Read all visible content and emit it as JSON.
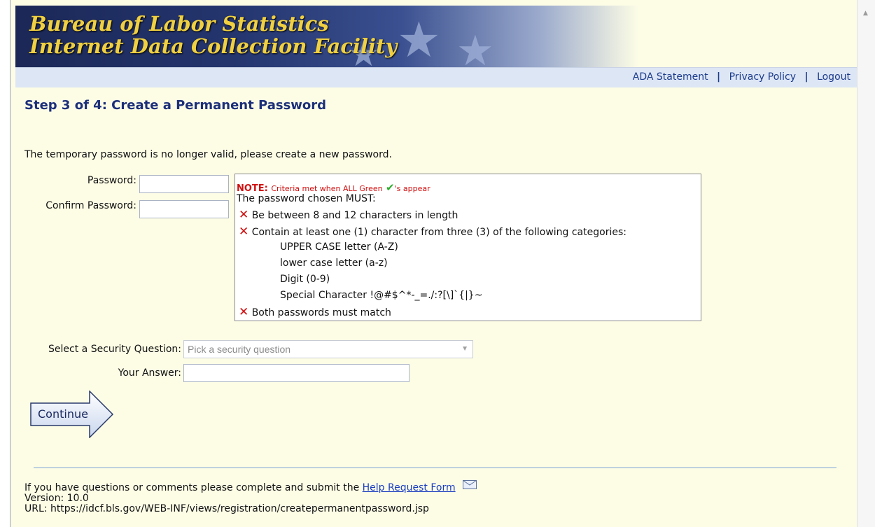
{
  "banner": {
    "line1": "Bureau of Labor Statistics",
    "line2": "Internet Data Collection Facility"
  },
  "nav": {
    "links": [
      "ADA Statement",
      "Privacy Policy",
      "Logout"
    ],
    "separator": "|"
  },
  "page": {
    "step_title": "Step 3 of 4: Create a Permanent Password",
    "intro": "The temporary password is no longer valid, please create a new password."
  },
  "form": {
    "password_label": "Password:",
    "password_value": "",
    "confirm_label": "Confirm Password:",
    "confirm_value": "",
    "security_label": "Select a Security Question:",
    "security_placeholder": "Pick a security question",
    "answer_label": "Your Answer:",
    "answer_value": "",
    "continue_label": "Continue"
  },
  "criteria": {
    "note_label": "NOTE:",
    "note_text_before": "Criteria met when ALL Green",
    "note_text_after": "'s appear",
    "heading": "The password chosen MUST:",
    "rule_length": "Be between 8 and 12 characters in length",
    "rule_categories": "Contain at least one (1) character from three (3) of the following categories:",
    "categories": [
      "UPPER CASE letter (A-Z)",
      "lower case letter (a-z)",
      "Digit (0-9)",
      "Special Character !@#$^*-_=./:?[\\]`{|}~"
    ],
    "rule_match": "Both passwords must match",
    "status_icon": "red-x-icon",
    "note_icon": "green-check-icon"
  },
  "footer": {
    "help_text": "If you have questions or comments please complete and submit the",
    "help_link": "Help Request Form",
    "version": "Version: 10.0",
    "url": "URL: https://idcf.bls.gov/WEB-INF/views/registration/createpermanentpassword.jsp"
  },
  "colors": {
    "page_background": "#fdfde6",
    "nav_strip": "#dde6f5",
    "title_blue": "#1c2f7a",
    "error_red": "#d01010",
    "success_green": "#2cae2c",
    "banner_gold": "#f0d040"
  }
}
